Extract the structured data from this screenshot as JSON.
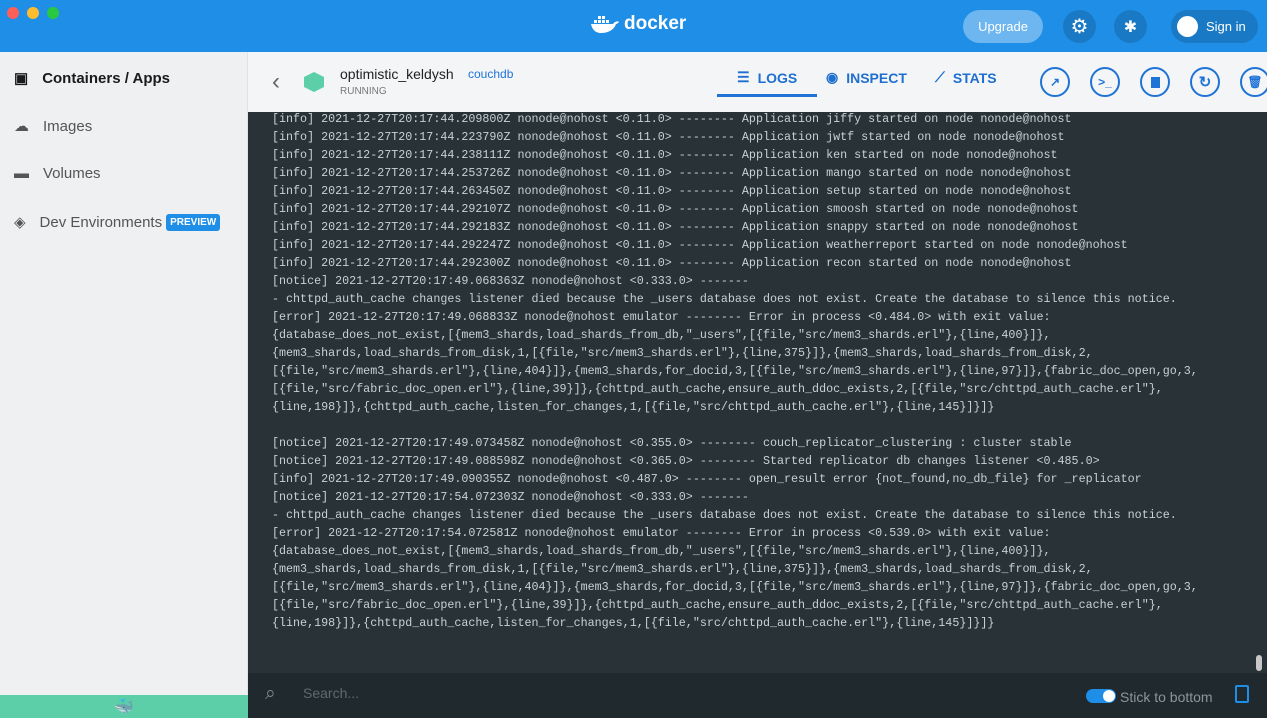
{
  "titlebar": {
    "brand": "docker",
    "upgrade": "Upgrade",
    "signin": "Sign in"
  },
  "sidebar": {
    "items": [
      {
        "label": "Containers / Apps"
      },
      {
        "label": "Images"
      },
      {
        "label": "Volumes"
      },
      {
        "label": "Dev Environments",
        "badge": "PREVIEW"
      }
    ]
  },
  "header": {
    "name": "optimistic_keldysh",
    "image": "couchdb",
    "status": "RUNNING",
    "tabs": [
      "LOGS",
      "INSPECT",
      "STATS"
    ]
  },
  "logs": [
    "[info] 2021-12-27T20:17:44.209800Z nonode@nohost <0.11.0> -------- Application jiffy started on node nonode@nohost",
    "[info] 2021-12-27T20:17:44.223790Z nonode@nohost <0.11.0> -------- Application jwtf started on node nonode@nohost",
    "[info] 2021-12-27T20:17:44.238111Z nonode@nohost <0.11.0> -------- Application ken started on node nonode@nohost",
    "[info] 2021-12-27T20:17:44.253726Z nonode@nohost <0.11.0> -------- Application mango started on node nonode@nohost",
    "[info] 2021-12-27T20:17:44.263450Z nonode@nohost <0.11.0> -------- Application setup started on node nonode@nohost",
    "[info] 2021-12-27T20:17:44.292107Z nonode@nohost <0.11.0> -------- Application smoosh started on node nonode@nohost",
    "[info] 2021-12-27T20:17:44.292183Z nonode@nohost <0.11.0> -------- Application snappy started on node nonode@nohost",
    "[info] 2021-12-27T20:17:44.292247Z nonode@nohost <0.11.0> -------- Application weatherreport started on node nonode@nohost",
    "[info] 2021-12-27T20:17:44.292300Z nonode@nohost <0.11.0> -------- Application recon started on node nonode@nohost",
    "[notice] 2021-12-27T20:17:49.068363Z nonode@nohost <0.333.0> -------",
    "- chttpd_auth_cache changes listener died because the _users database does not exist. Create the database to silence this notice.",
    "[error] 2021-12-27T20:17:49.068833Z nonode@nohost emulator -------- Error in process <0.484.0> with exit value:",
    "{database_does_not_exist,[{mem3_shards,load_shards_from_db,\"_users\",[{file,\"src/mem3_shards.erl\"},{line,400}]},",
    "{mem3_shards,load_shards_from_disk,1,[{file,\"src/mem3_shards.erl\"},{line,375}]},{mem3_shards,load_shards_from_disk,2,",
    "[{file,\"src/mem3_shards.erl\"},{line,404}]},{mem3_shards,for_docid,3,[{file,\"src/mem3_shards.erl\"},{line,97}]},{fabric_doc_open,go,3,",
    "[{file,\"src/fabric_doc_open.erl\"},{line,39}]},{chttpd_auth_cache,ensure_auth_ddoc_exists,2,[{file,\"src/chttpd_auth_cache.erl\"},",
    "{line,198}]},{chttpd_auth_cache,listen_for_changes,1,[{file,\"src/chttpd_auth_cache.erl\"},{line,145}]}]}",
    "",
    "[notice] 2021-12-27T20:17:49.073458Z nonode@nohost <0.355.0> -------- couch_replicator_clustering : cluster stable",
    "[notice] 2021-12-27T20:17:49.088598Z nonode@nohost <0.365.0> -------- Started replicator db changes listener <0.485.0>",
    "[info] 2021-12-27T20:17:49.090355Z nonode@nohost <0.487.0> -------- open_result error {not_found,no_db_file} for _replicator",
    "[notice] 2021-12-27T20:17:54.072303Z nonode@nohost <0.333.0> -------",
    "- chttpd_auth_cache changes listener died because the _users database does not exist. Create the database to silence this notice.",
    "[error] 2021-12-27T20:17:54.072581Z nonode@nohost emulator -------- Error in process <0.539.0> with exit value:",
    "{database_does_not_exist,[{mem3_shards,load_shards_from_db,\"_users\",[{file,\"src/mem3_shards.erl\"},{line,400}]},",
    "{mem3_shards,load_shards_from_disk,1,[{file,\"src/mem3_shards.erl\"},{line,375}]},{mem3_shards,load_shards_from_disk,2,",
    "[{file,\"src/mem3_shards.erl\"},{line,404}]},{mem3_shards,for_docid,3,[{file,\"src/mem3_shards.erl\"},{line,97}]},{fabric_doc_open,go,3,",
    "[{file,\"src/fabric_doc_open.erl\"},{line,39}]},{chttpd_auth_cache,ensure_auth_ddoc_exists,2,[{file,\"src/chttpd_auth_cache.erl\"},",
    "{line,198}]},{chttpd_auth_cache,listen_for_changes,1,[{file,\"src/chttpd_auth_cache.erl\"},{line,145}]}]}"
  ],
  "footer": {
    "search_placeholder": "Search...",
    "stick_label": "Stick to bottom",
    "stick_on": true
  }
}
